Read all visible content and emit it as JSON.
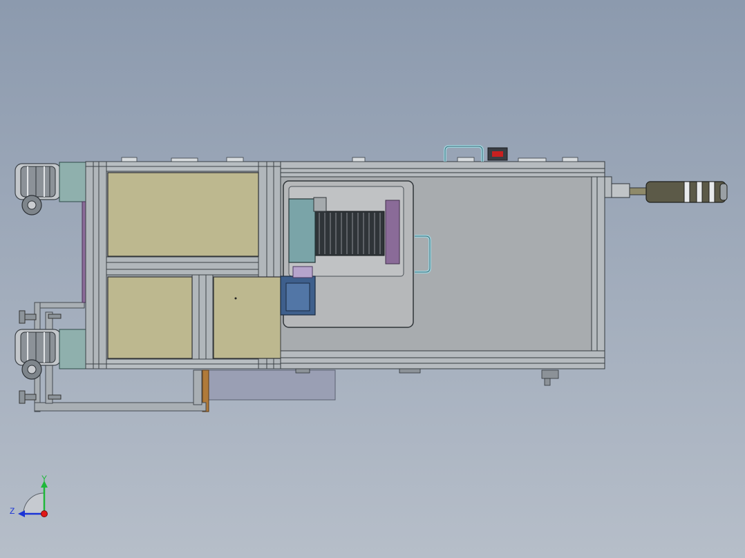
{
  "viewport": {
    "background_top": "#8c9aae",
    "background_bottom": "#b6bec9"
  },
  "triad": {
    "y_axis_label": "Y",
    "z_axis_label": "Z",
    "y_axis_color": "#1fb83a",
    "z_axis_color": "#1a33d6",
    "x_axis_color": "#e01818"
  },
  "colors": {
    "frame_metal": "#9aa1a6",
    "frame_dark": "#5a6168",
    "panel_khaki": "#bdb88f",
    "cover_grey": "#a8acaf",
    "window_grey": "#b6b8ba",
    "purple": "#8a6b98",
    "teal_block": "#7aa4a8",
    "blue_block": "#3e5f8c",
    "heatsink": "#2f3438",
    "handle_cyan": "#9fd2dc",
    "red_label": "#c82020",
    "brown_strip": "#b07a3a",
    "tray_grey": "#9a9fb4"
  }
}
